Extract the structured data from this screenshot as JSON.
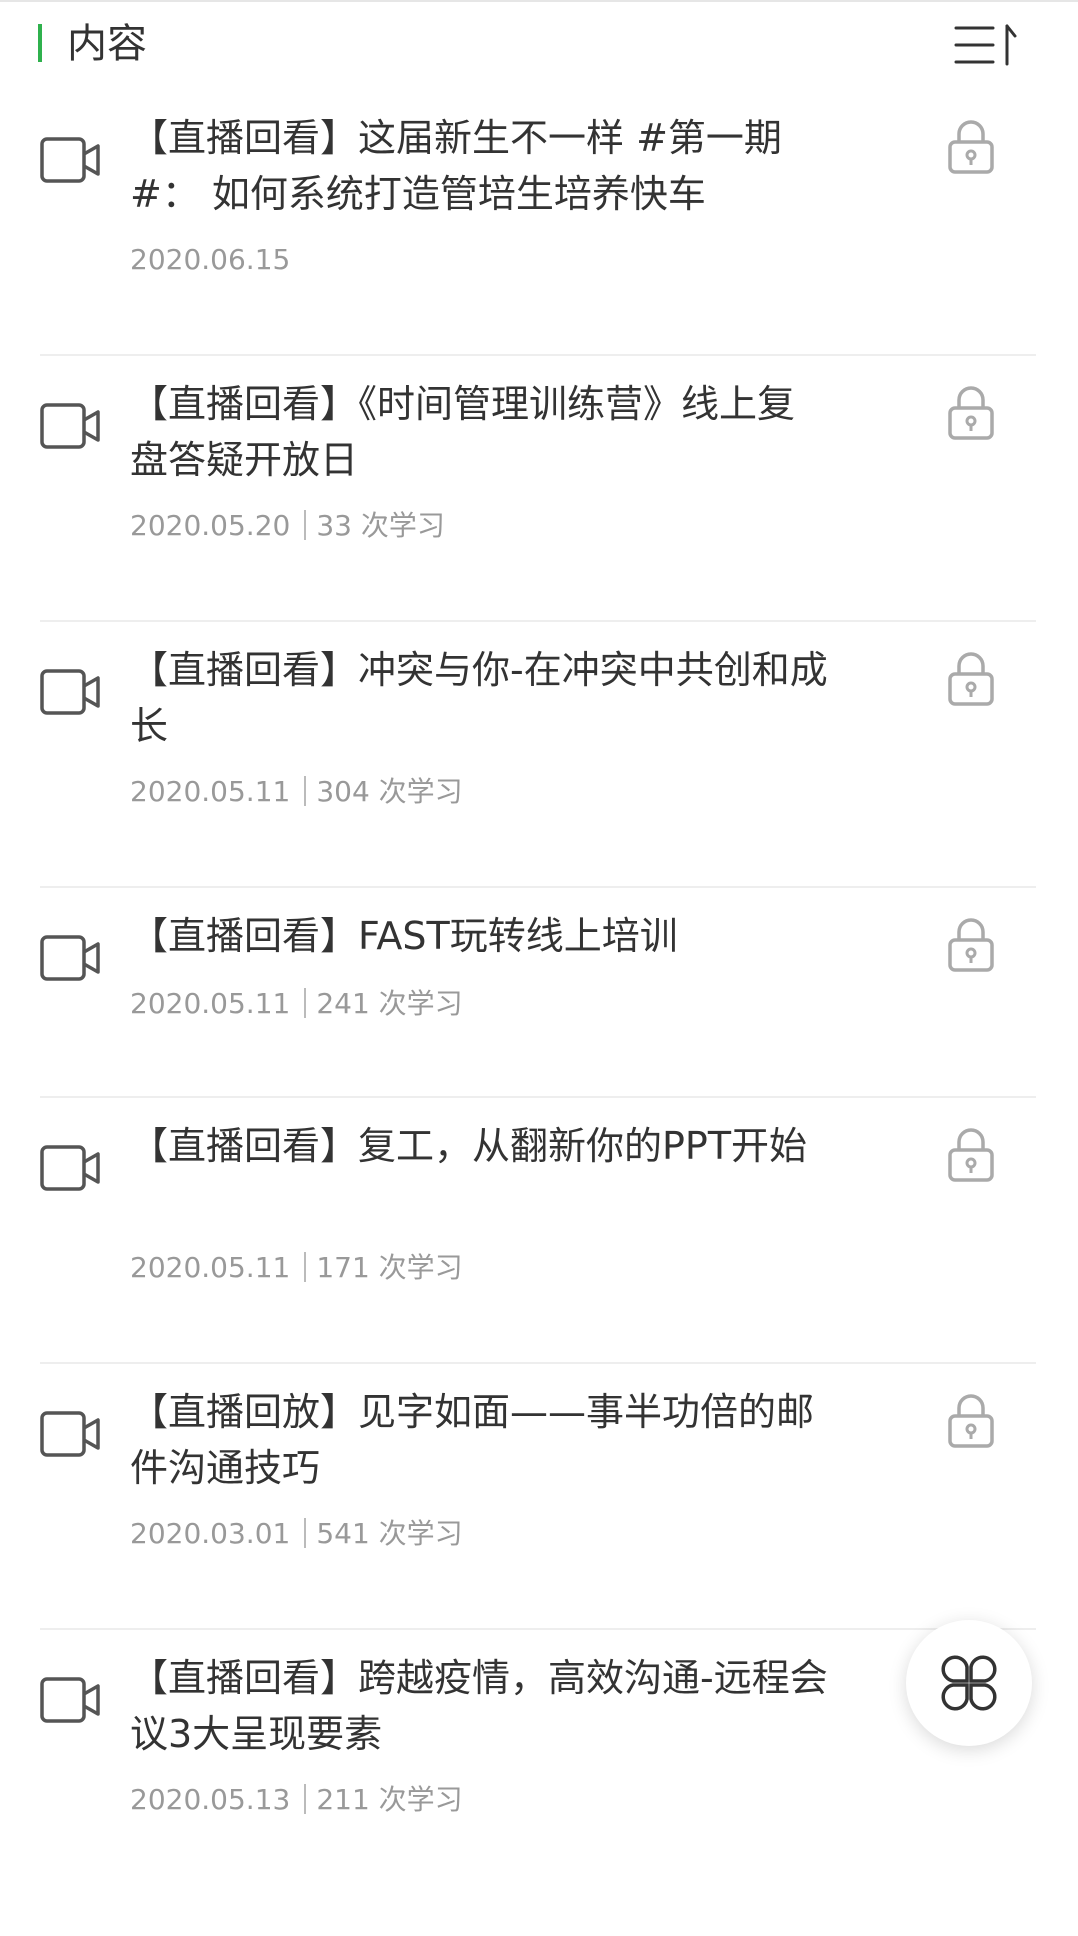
{
  "header": {
    "title": "内容",
    "accent_color": "#2fb14d",
    "sort_icon": "sort-list-icon"
  },
  "items": [
    {
      "title": "【直播回看】这届新生不一样 #第一期#： 如何系统打造管培生培养快车",
      "date": "2020.06.15",
      "views": ""
    },
    {
      "title": "【直播回看】《时间管理训练营》线上复盘答疑开放日",
      "date": "2020.05.20",
      "views": "33 次学习"
    },
    {
      "title": "【直播回看】冲突与你-在冲突中共创和成长",
      "date": "2020.05.11",
      "views": "304 次学习"
    },
    {
      "title": "【直播回看】FAST玩转线上培训",
      "date": "2020.05.11",
      "views": "241 次学习"
    },
    {
      "title": "【直播回看】复工，从翻新你的PPT开始",
      "date": "2020.05.11",
      "views": "171 次学习"
    },
    {
      "title": "【直播回放】见字如面——事半功倍的邮件沟通技巧",
      "date": "2020.03.01",
      "views": "541 次学习"
    },
    {
      "title": "【直播回看】跨越疫情，高效沟通-远程会议3大呈现要素",
      "date": "2020.05.13",
      "views": "211 次学习"
    }
  ],
  "icons": {
    "item": "video-camera-icon",
    "locked": "lock-icon",
    "fab": "clover-menu-icon"
  }
}
